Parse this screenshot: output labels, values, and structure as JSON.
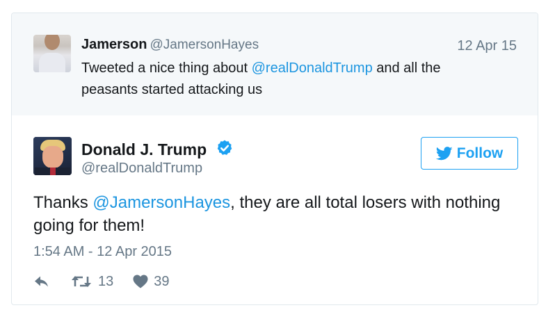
{
  "parent_tweet": {
    "name": "Jamerson",
    "handle": "@JamersonHayes",
    "date": "12 Apr 15",
    "text_before": "Tweeted a nice thing about ",
    "mention": "@realDonaldTrump",
    "text_after": " and all the peasants started attacking us"
  },
  "tweet": {
    "name": "Donald J. Trump",
    "handle": "@realDonaldTrump",
    "text_before": "Thanks ",
    "mention": "@JamersonHayes",
    "text_after": ", they are all total losers with nothing going for them!",
    "timestamp": "1:54 AM - 12 Apr 2015",
    "retweets": "13",
    "likes": "39"
  },
  "follow_button": {
    "label": "Follow"
  },
  "icons": {
    "verified": "verified-badge-icon",
    "follow": "twitter-bird-icon",
    "reply": "reply-icon",
    "retweet": "retweet-icon",
    "like": "heart-icon"
  },
  "colors": {
    "accent": "#1da1f2",
    "mention": "#1b95e0",
    "secondary_text": "#657786",
    "parent_background": "#f5f8fa"
  }
}
